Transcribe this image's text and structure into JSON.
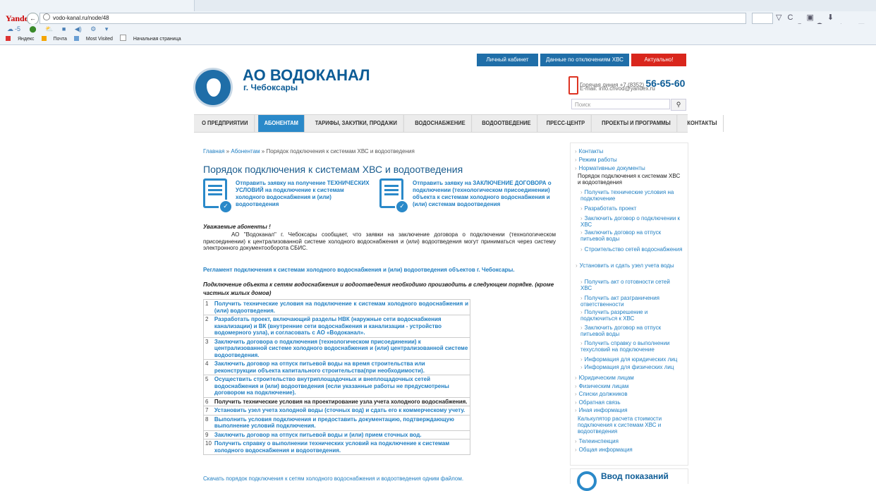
{
  "browser": {
    "brand": "Yandex",
    "url": "vodo-kanal.ru/node/48",
    "back": "←",
    "addon_icons": [
      "-5",
      "☁",
      "⬤",
      "⛅",
      "■",
      "◀)",
      "⚙",
      "▾"
    ],
    "toolbar_icons": "▽C ▣ ⬇ ☁-5 ⬤ ☆ ▤ ^ ≡",
    "bookmarks": [
      "Яндекс",
      "Почта",
      "Most Visited",
      "Начальная страница"
    ]
  },
  "top_buttons": [
    "Личный кабинет",
    "Данные по отключениям ХВС",
    "Актуально!"
  ],
  "site": {
    "title": "АО ВОДОКАНАЛ",
    "city": "г. Чебоксары",
    "hotline_label": "Горячая линия +7 (8352)",
    "hotline_number": "56-65-60",
    "email": "E-mail: info.chvod@yandex.ru",
    "search_placeholder": "Поиск",
    "search_icon": "🔍"
  },
  "menu": [
    "О ПРЕДПРИЯТИИ",
    "АБОНЕНТАМ",
    "ТАРИФЫ, ЗАКУПКИ, ПРОДАЖИ",
    "ВОДОСНАБЖЕНИЕ",
    "ВОДООТВЕДЕНИЕ",
    "ПРЕСС-ЦЕНТР",
    "ПРОЕКТЫ И ПРОГРАММЫ",
    "КОНТАКТЫ"
  ],
  "breadcrumb": {
    "home": "Главная",
    "sep": " » ",
    "section": "Абонентам",
    "current": "Порядок подключения к системам ХВС и водоотведения"
  },
  "page_title": "Порядок подключения к системам ХВС и водоотведения",
  "request_links": [
    "Отправить заявку на получение ТЕХНИЧЕСКИХ УСЛОВИЙ на подключение к системам холодного водоснабжения и (или) водоотведения",
    "Отправить заявку на ЗАКЛЮЧЕНИЕ ДОГОВОРА о подключении (технологическом присоединении) объекта к системам холодного водоснабжения и (или) системам водоотведения"
  ],
  "dear": "Уважаемые абоненты !",
  "notice": "АО \"Водоканал\" г. Чебоксары сообщает, что заявки на заключение договора о подключении (технологическом присоединении) к централизованной системе холодного водоснабжения и (или) водоотведения могут приниматься через систему электронного документооборота СБИС.",
  "regulation_link": "Регламент подключения к системам холодного водоснабжения и (или) водоотведения объектов г. Чебоксары.",
  "order_text": "Подключение объекта к сетям водоснабжения и водоотведения необходимо производить в следующем порядке. (кроме частных жилых домов)",
  "steps": [
    {
      "n": "1",
      "text": "Получить технические условия на подключение к системам холодного водоснабжения и (или) водоотведения."
    },
    {
      "n": "2",
      "text": "Разработать проект, включающий разделы НВК (наружные сети водоснабжения канализации) и ВК (внутренние сети водоснабжения и канализации - устройство водомерного узла), и согласовать с АО «Водоканал»."
    },
    {
      "n": "3",
      "text": "Заключить договора о подключения (технологическом присоединении) к централизованной системе холодного водоснабжения и (или) централизованной системе водоотведения."
    },
    {
      "n": "4",
      "text": "Заключить договор на отпуск питьевой воды на время строительства или реконструкции объекта капитального строительства(при необходимости)."
    },
    {
      "n": "5",
      "text": "Осуществить строительство внутриплощадочных и внеплощадочных сетей водоснабжения и (или) водоотведения (если указанные работы не предусмотрены договором на подключение)."
    },
    {
      "n": "6",
      "text": "Получить технические условия на проектирование узла учета холодного водоснабжения."
    },
    {
      "n": "7",
      "text": "Установить узел учета холодной воды (сточных вод) и сдать его к коммерческому учету."
    },
    {
      "n": "8",
      "text": "Выполнить условия подключения и предоставить документацию, подтверждающую выполнение условий подключения."
    },
    {
      "n": "9",
      "text": "Заключить договор на отпуск питьевой воды и (или) прием сточных вод."
    },
    {
      "n": "10",
      "text": "Получить справку о выполнении технических условий на подключение к системам холодного водоснабжения и водоотведения."
    }
  ],
  "download_link": "Скачать порядок подключения к сетям холодного водоснабжения и водоотведения одним файлом.",
  "sidebar": {
    "top": [
      "Контакты",
      "Режим работы",
      "Нормативные документы"
    ],
    "current": "Порядок подключения к системам ХВС и водоотведения",
    "sub": [
      "Получить технические условия на подключение",
      "Разработать проект",
      "Заключить договор о подключении к ХВС",
      "Заключить договор на отпуск питьевой воды",
      "Строительство сетей водоснабжения",
      "Установить и сдать узел учета воды",
      "Получить акт о готовности сетей ХВС",
      "Получить акт разграничения ответственности",
      "Получить разрешение и подключиться к ХВС",
      "Заключить договор на отпуск питьевой воды",
      "Получить справку о выполнении техусловий на подключение",
      "Информация для юридических лиц",
      "Информация для физических лиц"
    ],
    "bottom": [
      "Юридическим лицам",
      "Физическим лицам",
      "Списки должников",
      "Обратная связь",
      "Иная информация"
    ],
    "calc": "Калькулятор расчета стоимости подключения к системам ХВС и водоотведения",
    "bottom2": [
      "Телеинспекция",
      "Общая информация"
    ],
    "meter_label": "Ввод показаний"
  },
  "colors": {
    "accent": "#2a89c9",
    "brand": "#0d5c96",
    "top_btn": "#1f6ea8",
    "alert": "#d9261c"
  }
}
